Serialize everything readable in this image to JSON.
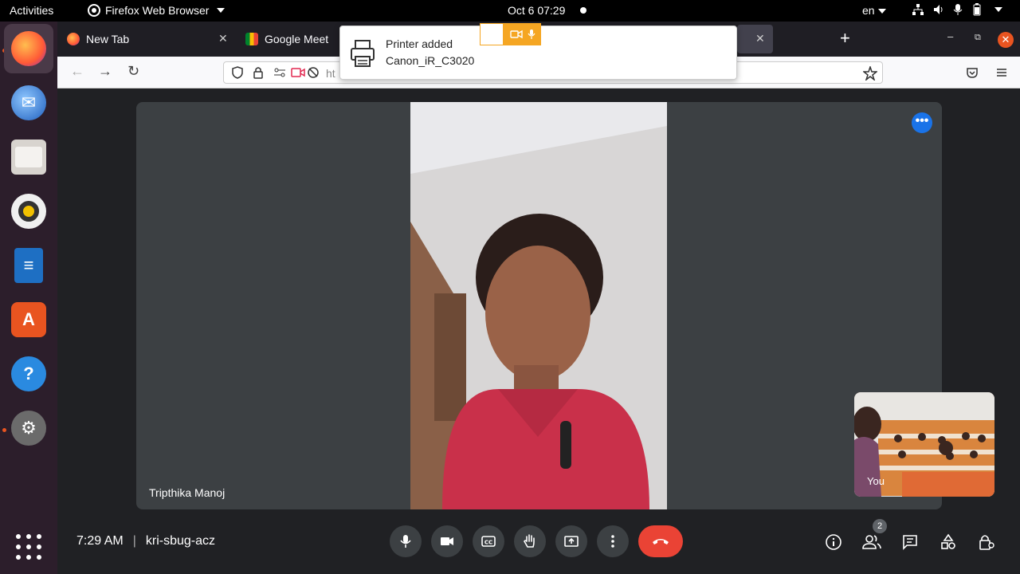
{
  "topbar": {
    "activities": "Activities",
    "app_name": "Firefox Web Browser",
    "clock": "Oct 6  07:29",
    "lang": "en"
  },
  "dock": {
    "items": [
      "firefox-icon",
      "thunderbird-icon",
      "files-icon",
      "rhythmbox-icon",
      "libreoffice-writer-icon",
      "software-icon",
      "help-icon",
      "settings-icon"
    ]
  },
  "browser": {
    "tabs": [
      {
        "label": "New Tab"
      },
      {
        "label": "Google Meet"
      }
    ],
    "url_text": "ht"
  },
  "notification": {
    "title": "Printer added",
    "body": "Canon_iR_C3020"
  },
  "meet": {
    "participant_name": "Tripthika Manoj",
    "self_label": "You",
    "time": "7:29 AM",
    "meeting_code": "kri-sbug-acz",
    "participant_count": "2",
    "end_call_color": "#ea4335",
    "accent_color": "#1a73e8"
  }
}
